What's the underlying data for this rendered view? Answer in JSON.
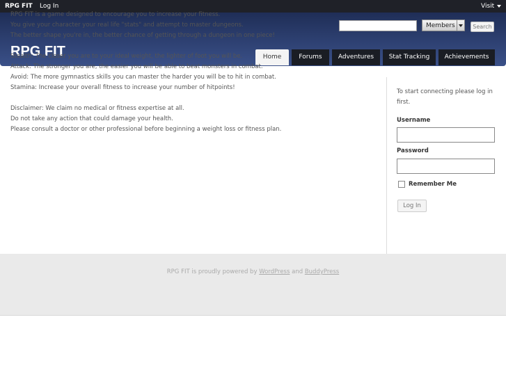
{
  "adminbar": {
    "site": "RPG FIT",
    "login": "Log In",
    "visit": "Visit"
  },
  "header": {
    "title": "RPG FIT",
    "search_value": "",
    "members_label": "Members",
    "search_button": "Search"
  },
  "nav": {
    "tabs": [
      {
        "label": "Home",
        "active": true
      },
      {
        "label": "Forums",
        "active": false
      },
      {
        "label": "Adventures",
        "active": false
      },
      {
        "label": "Stat Tracking",
        "active": false
      },
      {
        "label": "Achievements",
        "active": false
      }
    ]
  },
  "main": {
    "paragraphs": [
      [
        "RPG FIT is a game designed to encourage you to increase your fitness.",
        "You give your character your real life \"stats\" and attempt to master dungeons.",
        "The better shape you're in, the better chance of getting through a dungeon in one piece!"
      ],
      [
        "Stealth: The closer you are to your ideal weight, the lighter of foot you will be.",
        "Attack: The stronger you are, the easier you will be able to beat monsters in combat.",
        "Avoid: The more gymnastics skills you can master the harder you will be to hit in combat.",
        "Stamina: Increase your overall fitness to increase your number of hitpoints!"
      ],
      [
        "Disclaimer: We claim no medical or fitness expertise at all.",
        "Do not take any action that could damage your health.",
        "Please consult a doctor or other professional before beginning a weight loss or fitness plan."
      ]
    ]
  },
  "sidebar": {
    "intro": "To start connecting please log in first.",
    "username_label": "Username",
    "password_label": "Password",
    "remember_label": "Remember Me",
    "login_button": "Log In"
  },
  "footer": {
    "prefix": "RPG FIT is proudly powered by ",
    "link1": "WordPress",
    "middle": " and ",
    "link2": "BuddyPress"
  }
}
